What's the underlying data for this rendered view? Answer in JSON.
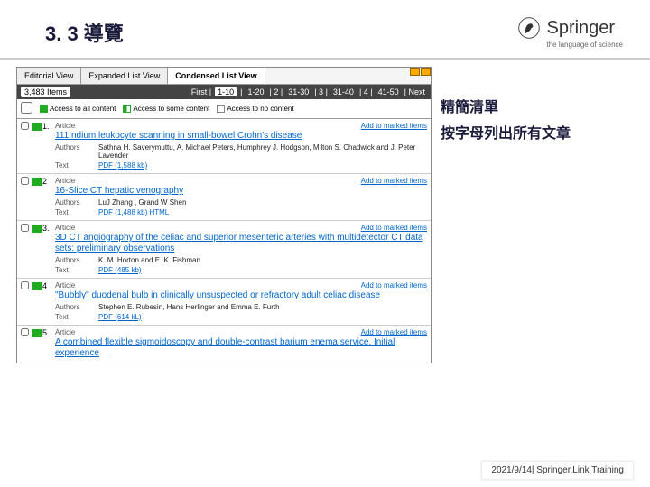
{
  "header": {
    "title": "3. 3 導覽",
    "brand": "Springer",
    "tagline": "the language of science"
  },
  "tabs": {
    "t0": "Editorial View",
    "t1": "Expanded List View",
    "t2": "Condensed List View"
  },
  "toolbar": {
    "count": "3,483 Items",
    "first": "First |",
    "p1": "1-10",
    "sep1": "|",
    "p2": "1-20",
    "sep2": "| 2 |",
    "p3": "31-30",
    "sep3": "| 3 |",
    "p4": "31-40",
    "sep4": "| 4 |",
    "p5": "41-50",
    "next": "| Next"
  },
  "legend": {
    "a": "Access to all content",
    "b": "Access to some content",
    "c": "Access to no content"
  },
  "labels": {
    "article": "Article",
    "authors": "Authors",
    "text": "Text",
    "add": "Add to marked items"
  },
  "items": [
    {
      "n": "1.",
      "title": "111Indium leukocyte scanning in small-bowel Crohn's disease",
      "authors": "Sathna H. Saverymuttu, A. Michael Peters, Humphrey J. Hodgson, Milton S. Chadwick and J. Peter Lavender",
      "text": "PDF (1,588 kb)"
    },
    {
      "n": "2",
      "title": "16-Slice CT hepatic venography",
      "authors": "LuJ Zhang , Grand W Shen",
      "text": "PDF (1,488 kb)   HTML"
    },
    {
      "n": "3.",
      "title": "3D CT angiography of the celiac and superior mesenteric arteries with multidetector CT data sets: preliminary observations",
      "authors": "K. M. Horton and E. K. Fishman",
      "text": "PDF (485 kb)"
    },
    {
      "n": "4",
      "title": "\"Bubbly\" duodenal bulb in clinically unsuspected or refractory adult celiac disease",
      "authors": "Stephen E. Rubesin, Hans Herlinger and Emma E. Furth",
      "text": "PDF (614 kL)"
    },
    {
      "n": "5.",
      "title": "A combined flexible sigmoidoscopy and double-contrast barium enema service. Initial experience",
      "authors": "",
      "text": ""
    }
  ],
  "side": {
    "a": "精簡清單",
    "b": "按字母列出所有文章"
  },
  "footer": "2021/9/14| Springer.Link Training"
}
